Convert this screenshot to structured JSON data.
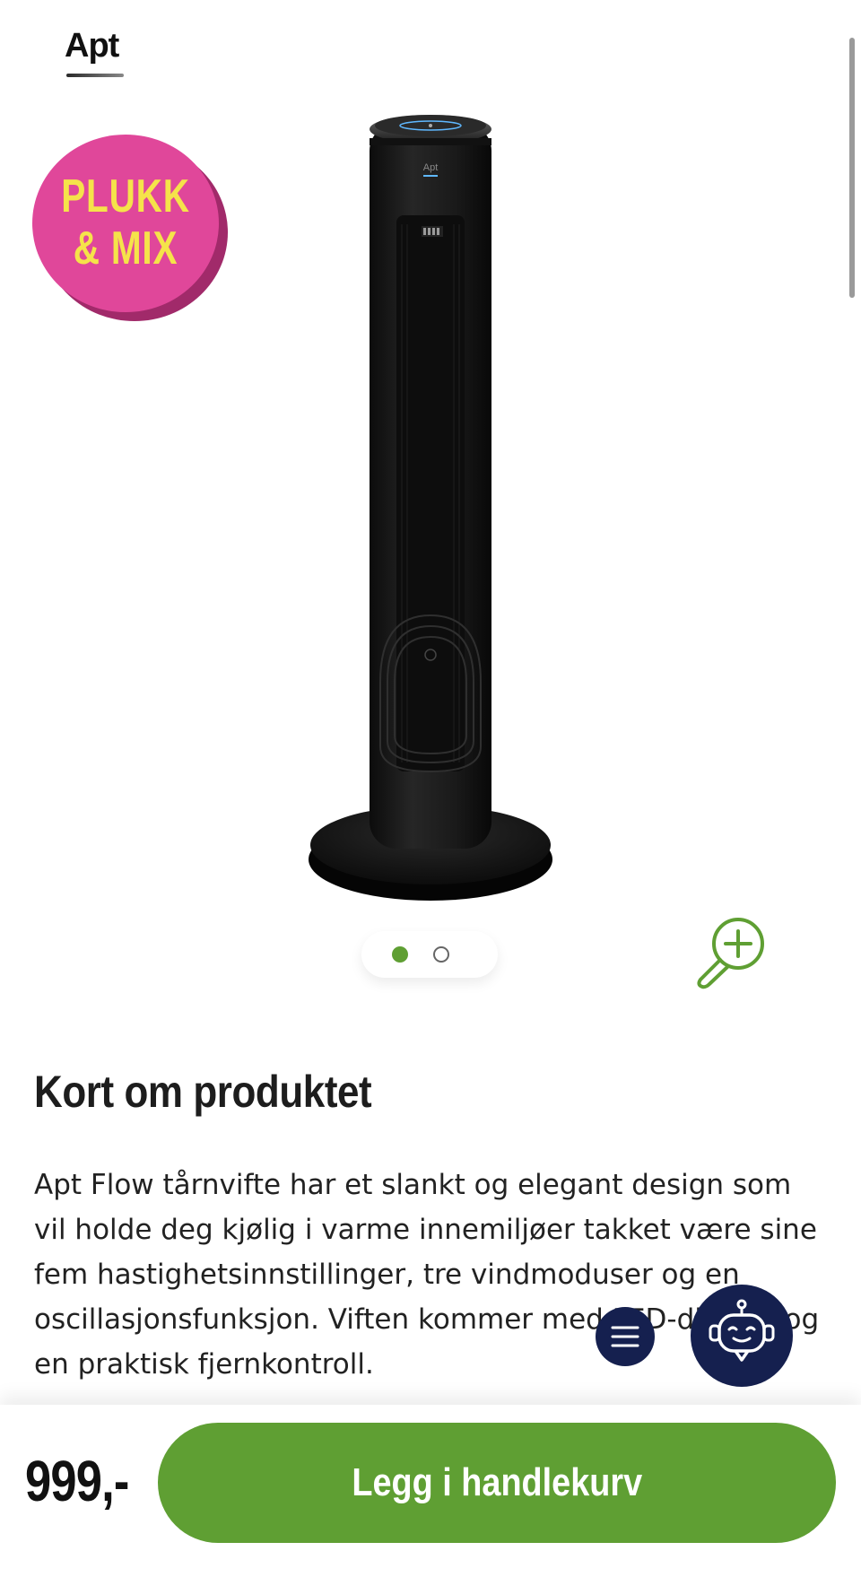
{
  "header": {
    "brand": "Apt"
  },
  "badge": {
    "line1": "PLUKK",
    "line2": "& MIX",
    "color": "#e0479a",
    "text_color": "#f5e34a"
  },
  "product": {
    "image_icon": "tower-fan-image",
    "image_brand_mark": "Apt",
    "carousel": {
      "total": 2,
      "active": 1
    }
  },
  "content": {
    "section_title": "Kort om produktet",
    "description": "Apt Flow tårnvifte har et slankt og elegant design som vil holde deg kjølig i varme innemiljøer takket være sine fem hastighetsinnstillinger, tre vindmoduser og en oscillasjonsfunksjon. Viften kommer med LED-display og en praktisk fjernkontroll."
  },
  "fab": {
    "menu_icon": "menu-icon",
    "chat_icon": "chat-robot-icon",
    "color": "#15204f"
  },
  "purchase": {
    "price": "999,-",
    "button_label": "Legg i handlekurv",
    "accent": "#5f9f33"
  }
}
